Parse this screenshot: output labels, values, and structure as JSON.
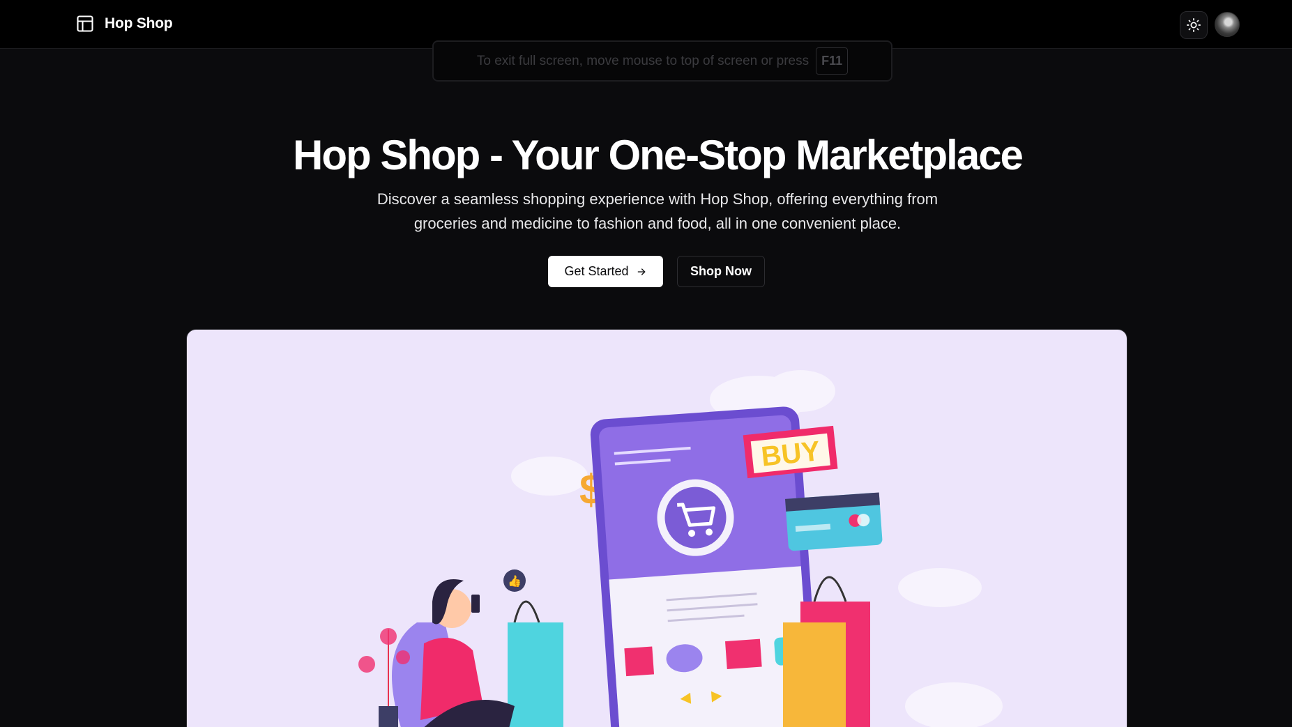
{
  "navbar": {
    "brand_name": "Hop Shop",
    "brand_icon": "layout-panel-icon",
    "theme_icon": "sun-icon"
  },
  "fullscreen_notice": {
    "text": "To exit full screen, move mouse to top of screen or press",
    "key": "F11"
  },
  "hero": {
    "title": "Hop Shop - Your One-Stop Marketplace",
    "subtitle_line1": "Discover a seamless shopping experience with Hop Shop, offering everything from",
    "subtitle_line2": "groceries and medicine to fashion and food, all in one convenient place.",
    "primary_button_label": "Get Started",
    "secondary_button_label": "Shop Now",
    "illustration_text": "BUY"
  },
  "colors": {
    "background": "#0b0b0d",
    "panel": "#ede5fb",
    "tablet": "#7b5cd6",
    "buy_bg": "#f02b6a",
    "buy_text": "#f7c325",
    "bag_teal": "#4fd4df",
    "bag_orange": "#f7b73a",
    "bag_pink": "#f0306f"
  }
}
